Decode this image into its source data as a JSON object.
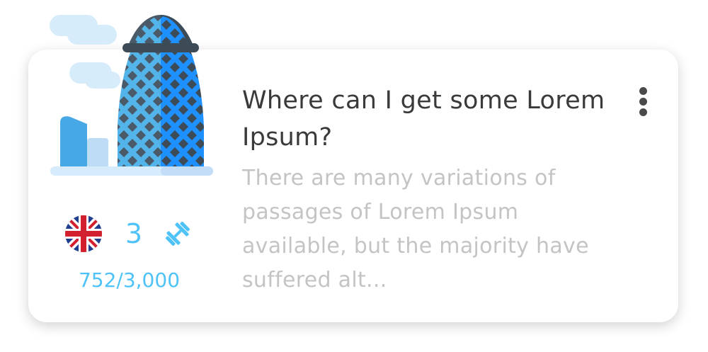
{
  "card": {
    "title": "Where can I get some Lorem Ipsum?",
    "description": "There are many variations of passages of Lorem Ipsum available, but the majority have suffered alt...",
    "illustration_icon": "gherkin-skyscraper-icon",
    "menu_icon": "more-vertical-icon"
  },
  "stats": {
    "language_icon": "uk-flag-icon",
    "level": "3",
    "difficulty_icon": "dumbbell-icon",
    "progress": "752/3,000"
  },
  "colors": {
    "accent": "#4fc3f7",
    "title": "#3a3a3a",
    "description": "#c4c4c4",
    "building_dark": "#4b5a68",
    "building_blue": "#1e90ff",
    "building_light_blue": "#53b4ea"
  }
}
